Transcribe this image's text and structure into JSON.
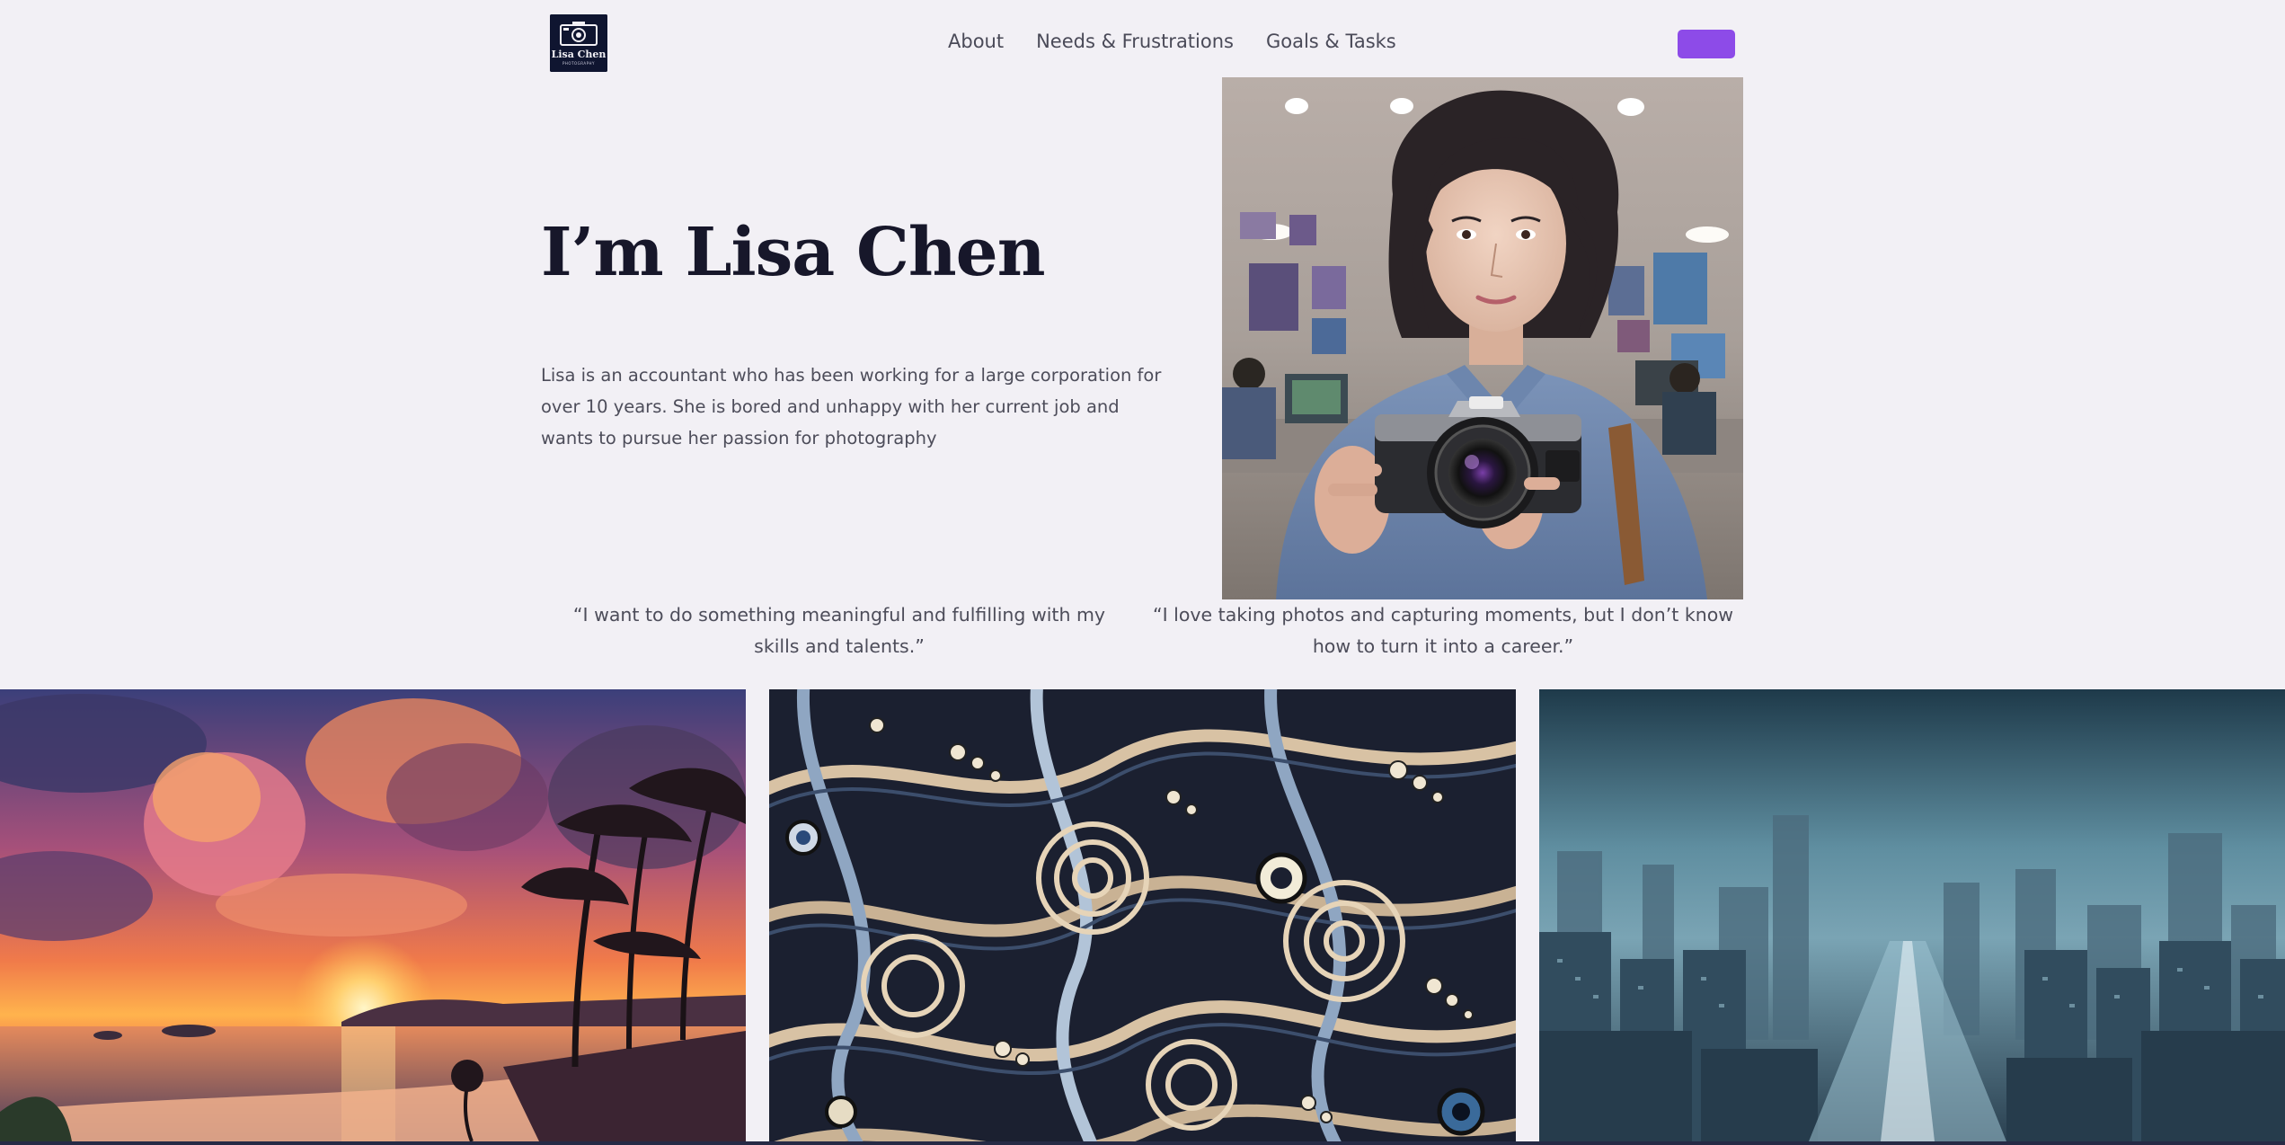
{
  "header": {
    "logo": {
      "name": "Lisa Chen",
      "tagline": "PHOTOGRAPHY",
      "icon": "camera-icon"
    },
    "nav": [
      {
        "label": "About"
      },
      {
        "label": "Needs & Frustrations"
      },
      {
        "label": "Goals & Tasks"
      }
    ],
    "cta_color": "#8d4be8"
  },
  "hero": {
    "title": "I’m Lisa Chen",
    "description": "Lisa is an accountant who has been working for a large corporation for over 10 years. She is bored and unhappy with her current job and wants to pursue her passion for photography"
  },
  "quotes": [
    "“I want to do something meaningful and fulfilling with my skills and talents.”",
    "“I love taking photos and capturing moments, but I don’t know how to turn it into a career.”"
  ],
  "colors": {
    "background": "#f2f0f5",
    "heading": "#17172a",
    "body_text": "#4d4d5a",
    "accent": "#8d4be8"
  }
}
